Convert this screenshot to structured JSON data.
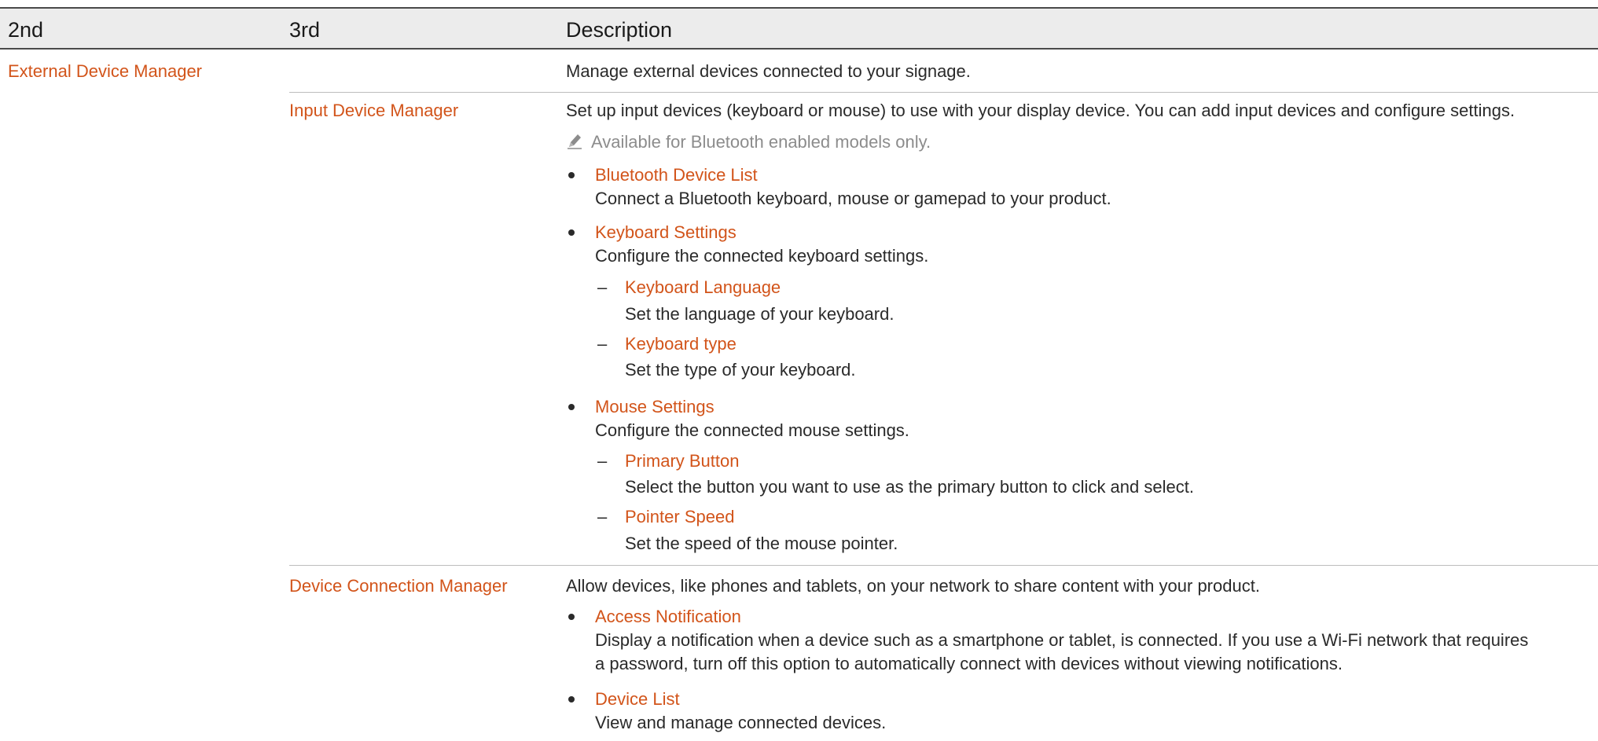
{
  "headers": [
    "2nd",
    "3rd",
    "Description"
  ],
  "section": {
    "title": "External Device Manager",
    "description": "Manage external devices connected to your signage."
  },
  "input_device_manager": {
    "title": "Input Device Manager",
    "description": "Set up input devices (keyboard or mouse) to use with your display device. You can add input devices and configure settings.",
    "note": "Available for Bluetooth enabled models only.",
    "bluetooth": {
      "title": "Bluetooth Device List",
      "description": "Connect a Bluetooth keyboard, mouse or gamepad to your product."
    },
    "keyboard": {
      "title": "Keyboard Settings",
      "description": "Configure the connected keyboard settings.",
      "language": {
        "title": "Keyboard Language",
        "description": "Set the language of your keyboard."
      },
      "type": {
        "title": "Keyboard type",
        "description": "Set the type of your keyboard."
      }
    },
    "mouse": {
      "title": "Mouse Settings",
      "description": "Configure the connected mouse settings.",
      "primary": {
        "title": "Primary Button",
        "description": "Select the button you want to use as the primary button to click and select."
      },
      "speed": {
        "title": "Pointer Speed",
        "description": "Set the speed of the mouse pointer."
      }
    }
  },
  "device_connection_manager": {
    "title": "Device Connection Manager",
    "description": "Allow devices, like phones and tablets, on your network to share content with your product.",
    "access": {
      "title": "Access Notification",
      "description_line1": "Display a notification when a device such as a smartphone or tablet, is connected. If you use a Wi-Fi network that requires",
      "description_line2": "a password, turn off this option to automatically connect with devices without viewing notifications."
    },
    "device_list": {
      "title": "Device List",
      "description": "View and manage connected devices."
    }
  },
  "icons": {
    "note": "pencil-icon"
  },
  "colors": {
    "accent": "#d2541a",
    "header_bg": "#ececec",
    "note_text": "#8c8c8c"
  }
}
